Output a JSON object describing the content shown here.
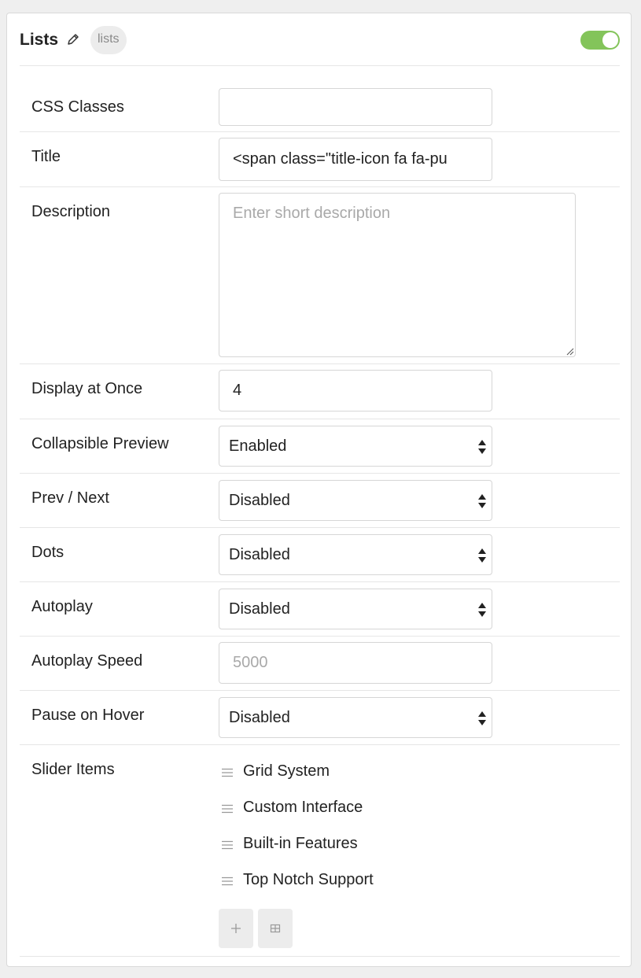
{
  "header": {
    "title": "Lists",
    "badge": "lists",
    "enabled": true,
    "toggle_color": "#83c45a"
  },
  "fields": {
    "css_classes": {
      "label": "CSS Classes",
      "value": ""
    },
    "title": {
      "label": "Title",
      "value": "<span class=\"title-icon fa fa-pu"
    },
    "description": {
      "label": "Description",
      "value": "",
      "placeholder": "Enter short description"
    },
    "display_at_once": {
      "label": "Display at Once",
      "value": "4"
    },
    "collapsible_preview": {
      "label": "Collapsible Preview",
      "value": "Enabled"
    },
    "prev_next": {
      "label": "Prev / Next",
      "value": "Disabled"
    },
    "dots": {
      "label": "Dots",
      "value": "Disabled"
    },
    "autoplay": {
      "label": "Autoplay",
      "value": "Disabled"
    },
    "autoplay_speed": {
      "label": "Autoplay Speed",
      "value": "",
      "placeholder": "5000"
    },
    "pause_on_hover": {
      "label": "Pause on Hover",
      "value": "Disabled"
    }
  },
  "slider_items": {
    "label": "Slider Items",
    "items": [
      "Grid System",
      "Custom Interface",
      "Built-in Features",
      "Top Notch Support"
    ],
    "add_icon": "plus-icon",
    "add_grid_icon": "grid-icon"
  }
}
